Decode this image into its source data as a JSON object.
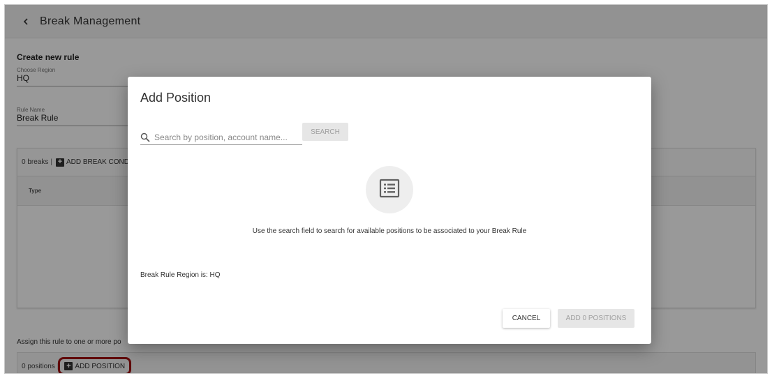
{
  "header": {
    "title": "Break Management",
    "back_icon": "chevron-left-icon"
  },
  "form": {
    "section_title": "Create new rule",
    "region": {
      "label": "Choose Region",
      "value": "HQ"
    },
    "rule_name": {
      "label": "Rule Name",
      "value": "Break Rule"
    }
  },
  "breaks": {
    "count_text": "0 breaks",
    "separator": "|",
    "add_label": "ADD BREAK COND",
    "column_type": "Type"
  },
  "assign": {
    "text": "Assign this rule to one or more po",
    "count_text": "0 positions",
    "separator": "|",
    "add_label": "ADD POSITION"
  },
  "dialog": {
    "title": "Add Position",
    "search_placeholder": "Search by position, account name...",
    "search_button": "SEARCH",
    "empty_icon": "list-icon",
    "empty_message": "Use the search field to search for available positions to be associated to your Break Rule",
    "region_text": "Break Rule Region is: HQ",
    "cancel_label": "CANCEL",
    "confirm_label": "ADD 0 POSITIONS"
  },
  "colors": {
    "highlight": "#a01010",
    "overlay": "rgba(0,0,0,0.4)"
  }
}
